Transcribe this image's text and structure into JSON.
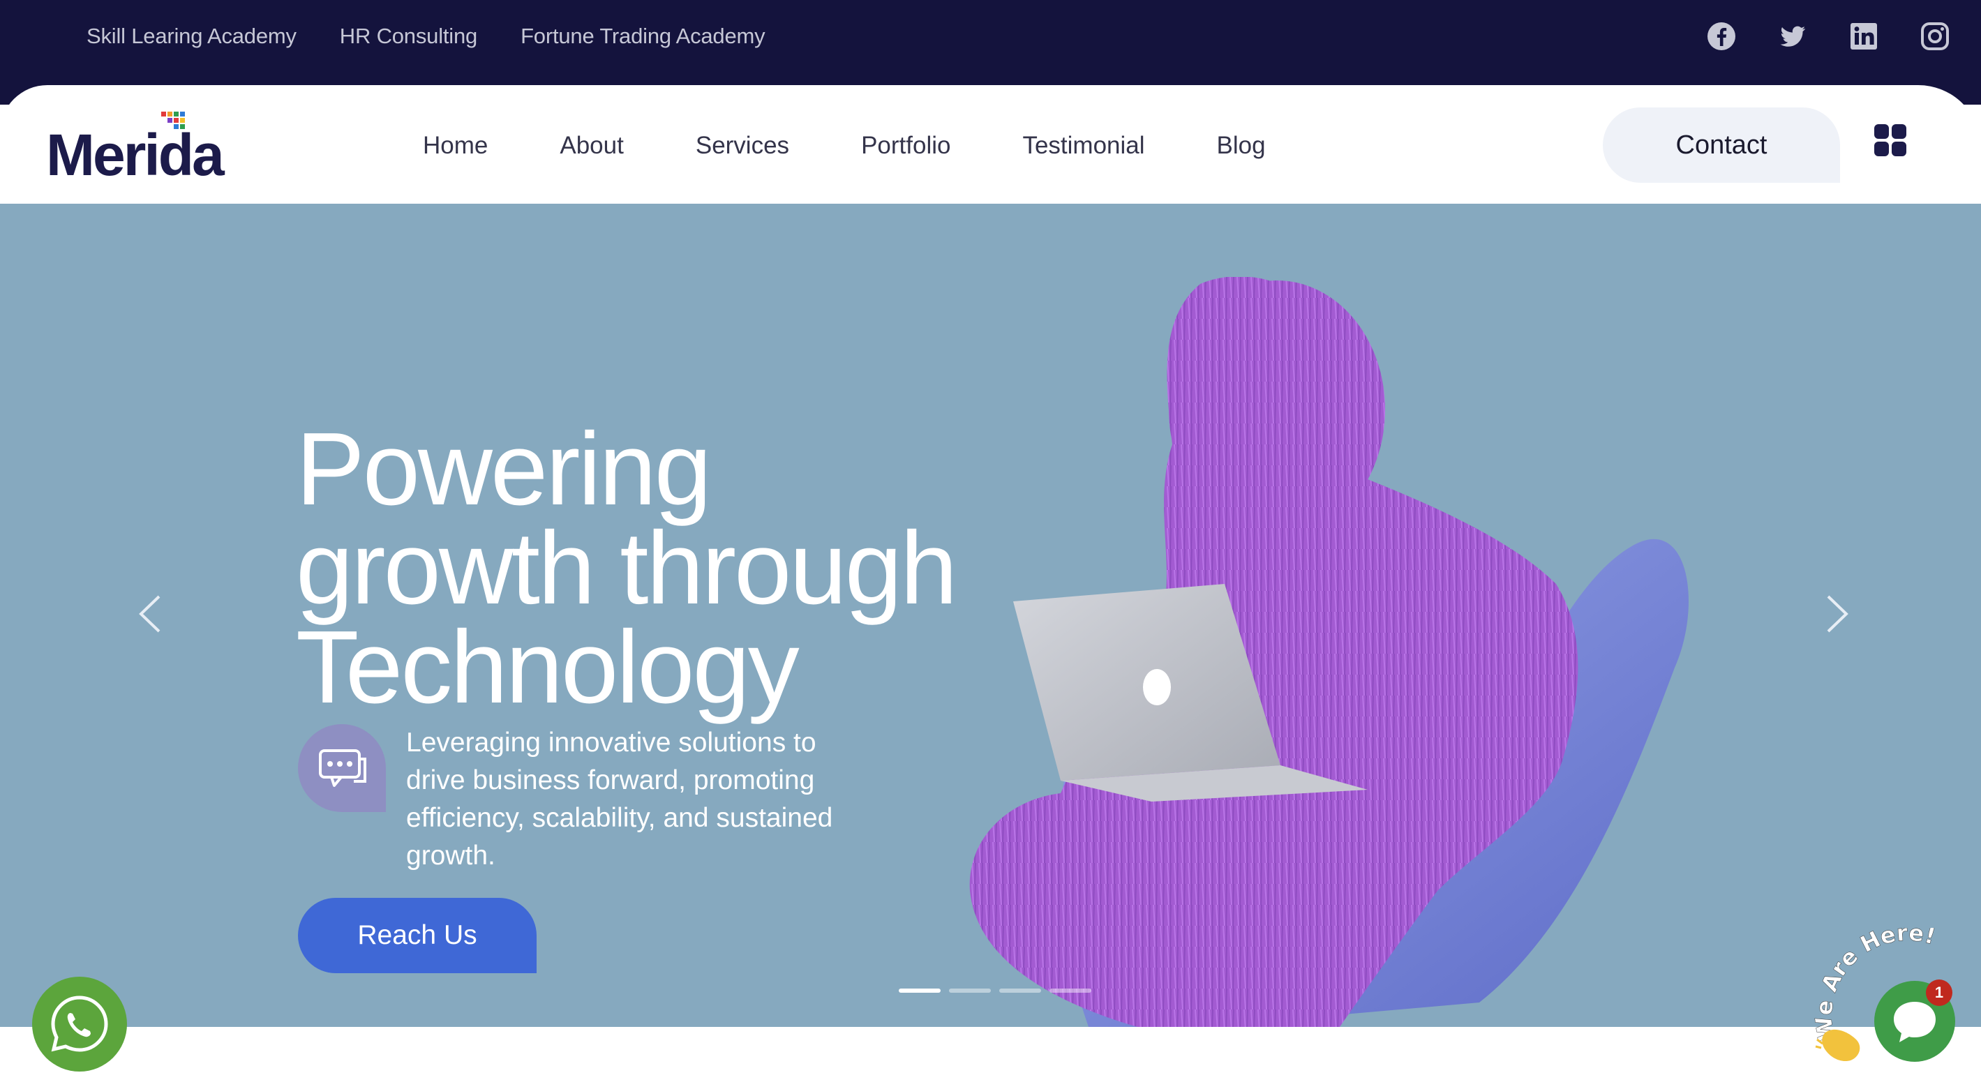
{
  "topbar": {
    "links": [
      "Skill Learing Academy",
      "HR Consulting",
      "Fortune Trading Academy"
    ],
    "social_icons": [
      "facebook-icon",
      "twitter-icon",
      "linkedin-icon",
      "instagram-icon"
    ]
  },
  "header": {
    "logo_text": "Merida",
    "nav": [
      "Home",
      "About",
      "Services",
      "Portfolio",
      "Testimonial",
      "Blog"
    ],
    "contact_label": "Contact",
    "menu_icon": "grid-menu-icon"
  },
  "hero": {
    "title_lines": [
      "Powering",
      "growth through",
      "Technology"
    ],
    "description": "Leveraging innovative solutions to drive business forward, promoting efficiency, scalability, and sustained growth.",
    "cta_label": "Reach Us",
    "slide_count": 4,
    "active_slide": 1,
    "bubble_icon": "chat-bubble-icon"
  },
  "widgets": {
    "whatsapp_icon": "whatsapp-icon",
    "chat_label": "We Are Here!",
    "chat_badge": "1"
  },
  "colors": {
    "topbar_bg": "#14133d",
    "hero_bg": "#86a9bf",
    "accent_blue": "#3f68d6",
    "brand_dark": "#1c1b4a",
    "whatsapp_green": "#5ca53c",
    "fur_purple": "#a85bd6",
    "chair_blue": "#7886d6"
  }
}
